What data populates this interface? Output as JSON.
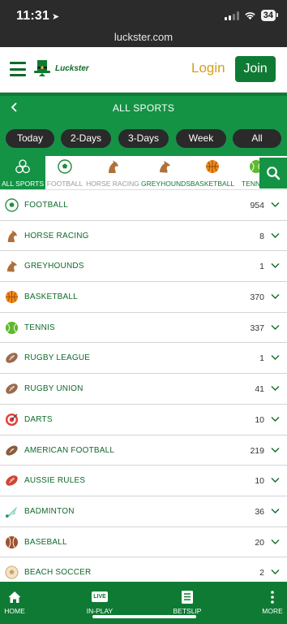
{
  "status_bar": {
    "time": "11:31",
    "battery": "34"
  },
  "browser": {
    "url": "luckster.com"
  },
  "header": {
    "logo_text": "Luckster",
    "login_label": "Login",
    "join_label": "Join"
  },
  "page": {
    "title": "ALL SPORTS"
  },
  "filters": [
    "Today",
    "2-Days",
    "3-Days",
    "Week",
    "All"
  ],
  "categories": [
    "ALL SPORTS",
    "FOOTBALL",
    "HORSE RACING",
    "GREYHOUNDS",
    "BASKETBALL",
    "TENNIS"
  ],
  "sports": [
    {
      "name": "FOOTBALL",
      "count": "954"
    },
    {
      "name": "HORSE RACING",
      "count": "8"
    },
    {
      "name": "GREYHOUNDS",
      "count": "1"
    },
    {
      "name": "BASKETBALL",
      "count": "370"
    },
    {
      "name": "TENNIS",
      "count": "337"
    },
    {
      "name": "RUGBY LEAGUE",
      "count": "1"
    },
    {
      "name": "RUGBY UNION",
      "count": "41"
    },
    {
      "name": "DARTS",
      "count": "10"
    },
    {
      "name": "AMERICAN FOOTBALL",
      "count": "219"
    },
    {
      "name": "AUSSIE RULES",
      "count": "10"
    },
    {
      "name": "BADMINTON",
      "count": "36"
    },
    {
      "name": "BASEBALL",
      "count": "20"
    },
    {
      "name": "BEACH SOCCER",
      "count": "2"
    }
  ],
  "bottom_nav": {
    "home": "HOME",
    "live_badge": "LIVE",
    "inplay": "IN-PLAY",
    "betslip": "BETSLIP",
    "more": "MORE"
  },
  "colors": {
    "brand_green": "#0f7a33",
    "header_green": "#149345",
    "accent_gold": "#d4a017"
  }
}
